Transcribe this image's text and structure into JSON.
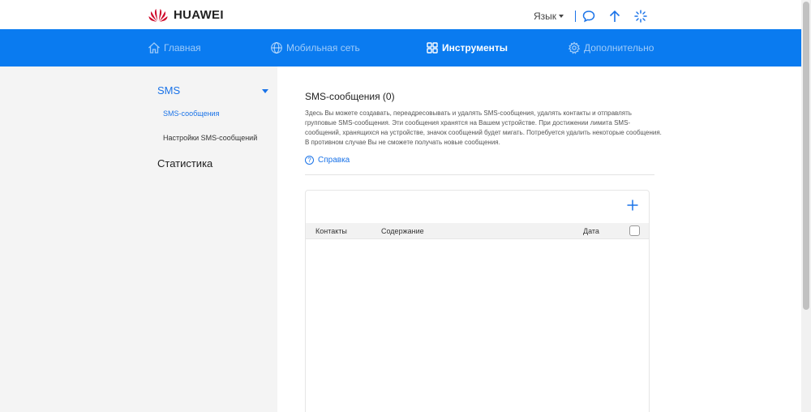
{
  "header": {
    "brand": "HUAWEI",
    "language_label": "Язык",
    "icons": [
      "chat-icon",
      "upload-arrow-icon",
      "loading-spinner-icon"
    ],
    "brand_color": "#cf0a2c"
  },
  "nav": {
    "items": [
      {
        "label": "Главная",
        "icon": "home-icon"
      },
      {
        "label": "Мобильная сеть",
        "icon": "globe-icon"
      },
      {
        "label": "Инструменты",
        "icon": "grid-tools-icon",
        "active": true
      },
      {
        "label": "Дополнительно",
        "icon": "gear-icon"
      }
    ],
    "bg_color": "#0a7bf0"
  },
  "sidebar": {
    "groups": [
      {
        "label": "SMS",
        "expanded": true,
        "items": [
          {
            "label": "SMS-сообщения",
            "active": true
          },
          {
            "label": "Настройки SMS-сообщений",
            "active": false
          }
        ]
      },
      {
        "label": "Статистика"
      }
    ]
  },
  "main": {
    "title": "SMS-сообщения (0)",
    "description": "Здесь Вы можете создавать, переадресовывать и удалять SMS-сообщения, удалять контакты и отправлять групповые SMS-сообщения. Эти сообщения хранятся на Вашем устройстве. При достижении лимита SMS-сообщений, хранящихся на устройстве, значок сообщений будет мигать. Потребуется удалить некоторые сообщения. В противном случае Вы не сможете получать новые сообщения.",
    "help_label": "Справка",
    "table": {
      "columns": [
        "Контакты",
        "Содержание",
        "Дата"
      ],
      "rows": []
    }
  },
  "colors": {
    "accent": "#1a73e8"
  }
}
